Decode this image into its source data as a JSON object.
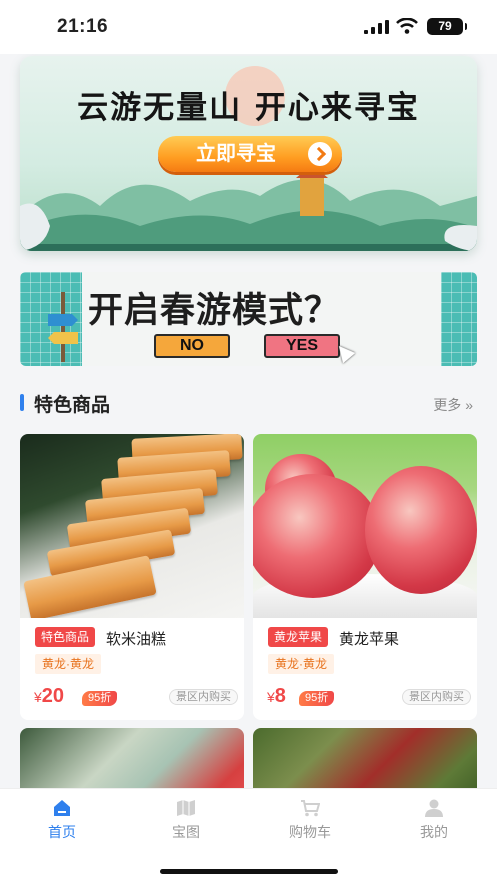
{
  "status_bar": {
    "time": "21:16",
    "battery": "79"
  },
  "banners": {
    "treasure": {
      "title": "云游无量山 开心来寻宝",
      "button_label": "立即寻宝"
    },
    "spring": {
      "title": "开启春游模式？",
      "no_label": "NO",
      "yes_label": "YES"
    }
  },
  "section": {
    "title": "特色商品",
    "more_label": "更多 »"
  },
  "products": [
    {
      "tag": "特色商品",
      "name": "软米油糕",
      "origin": "黄龙·黄龙",
      "price_symbol": "¥",
      "price": "20",
      "discount": "95折",
      "buy_note": "景区内购买"
    },
    {
      "tag": "黄龙苹果",
      "name": "黄龙苹果",
      "origin": "黄龙·黄龙",
      "price_symbol": "¥",
      "price": "8",
      "discount": "95折",
      "buy_note": "景区内购买"
    }
  ],
  "tabbar": {
    "tabs": [
      {
        "label": "首页",
        "icon": "home-icon",
        "active": true
      },
      {
        "label": "宝图",
        "icon": "map-icon",
        "active": false
      },
      {
        "label": "购物车",
        "icon": "cart-icon",
        "active": false
      },
      {
        "label": "我的",
        "icon": "user-icon",
        "active": false
      }
    ]
  },
  "colors": {
    "accent": "#2f80ed",
    "price": "#f04848",
    "button_orange": "#ff9d21"
  }
}
